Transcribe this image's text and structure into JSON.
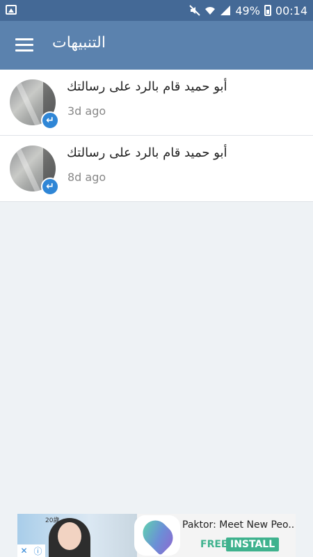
{
  "status_bar": {
    "battery": "49%",
    "time": "00:14",
    "icons": [
      "image-icon",
      "mute-icon",
      "wifi-icon",
      "signal-icon",
      "battery-icon"
    ]
  },
  "app_bar": {
    "title": "التنبيهات",
    "menu_icon": "hamburger-icon"
  },
  "notifications": [
    {
      "text": "أبو حميد قام بالرد على رسالتك",
      "time": "3d ago",
      "badge_icon": "reply-icon"
    },
    {
      "text": "أبو حميد قام بالرد على رسالتك",
      "time": "8d ago",
      "badge_icon": "reply-icon"
    }
  ],
  "ad": {
    "title": "Paktor: Meet New Peo...",
    "free_label": "FREE",
    "install_label": "INSTALL",
    "photo_text": "20歲",
    "close_icon": "close-icon",
    "info_icon": "info-icon"
  },
  "colors": {
    "status_bar": "#446996",
    "app_bar": "#5b82ae",
    "background": "#eef2f5",
    "badge": "#2f86d6",
    "install": "#3fb28e"
  }
}
